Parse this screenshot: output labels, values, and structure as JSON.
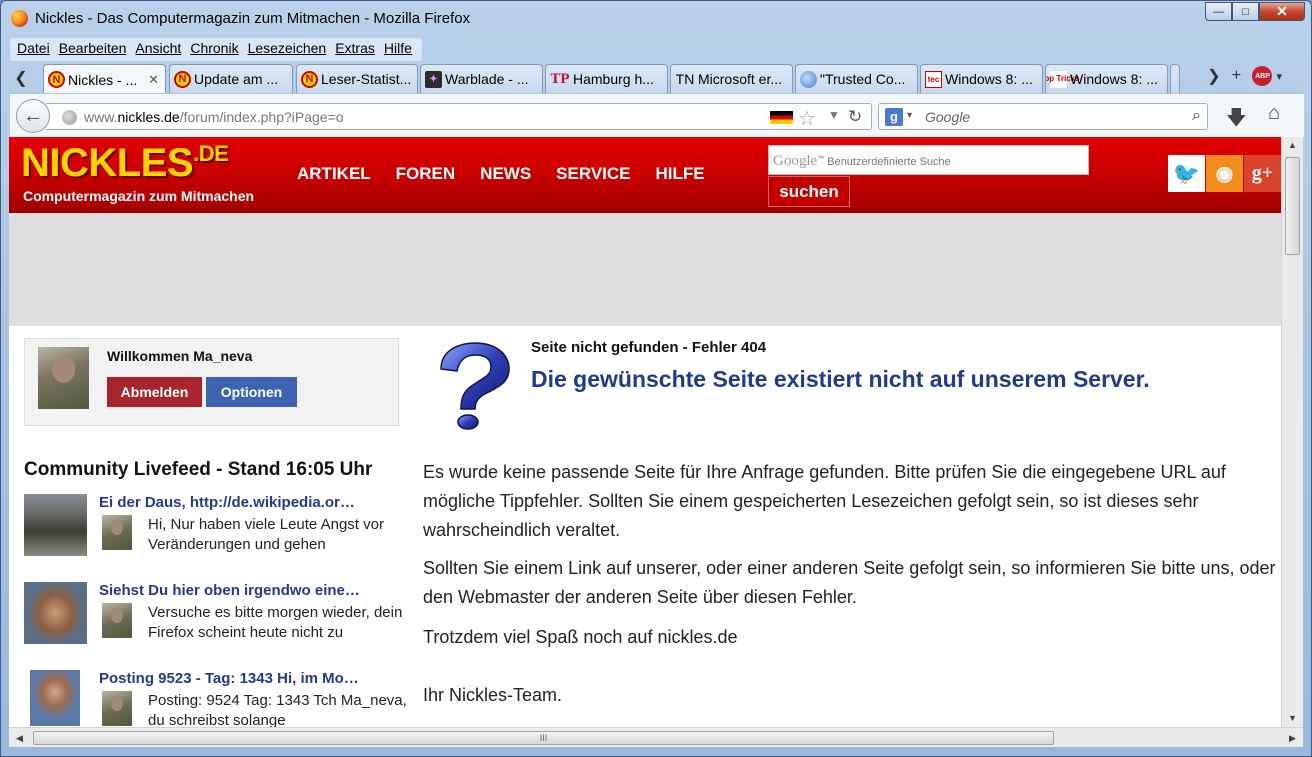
{
  "window": {
    "title": "Nickles - Das Computermagazin zum Mitmachen - Mozilla Firefox",
    "controls": {
      "minimize": "—",
      "maximize": "□",
      "close": "✕"
    }
  },
  "menubar": [
    "Datei",
    "Bearbeiten",
    "Ansicht",
    "Chronik",
    "Lesezeichen",
    "Extras",
    "Hilfe"
  ],
  "tabs": [
    {
      "label": "Nickles - ...",
      "icon": "nickles-n-icon",
      "active": true,
      "close": "✕"
    },
    {
      "label": "Update am ...",
      "icon": "nickles-n-icon"
    },
    {
      "label": "Leser-Statist...",
      "icon": "nickles-n-icon"
    },
    {
      "label": "Warblade - ...",
      "icon": "warblade-icon"
    },
    {
      "label": "Hamburg h...",
      "icon": "tp-icon",
      "icon_text": "TP"
    },
    {
      "label": "Microsoft er...",
      "icon": "tn-icon",
      "icon_text": "TN"
    },
    {
      "label": "\"Trusted Co...",
      "icon": "globe-icon"
    },
    {
      "label": "Windows 8: ...",
      "icon": "tec-icon",
      "icon_text": "tec"
    },
    {
      "label": "Windows 8: ...",
      "icon": "tipp-icon",
      "icon_text": "Tipp Tricks"
    }
  ],
  "tab_tools": {
    "scroll_left": "❮",
    "scroll_right": "❯",
    "new_tab": "+",
    "abp": "ABP",
    "abp_drop": "▾"
  },
  "navbar": {
    "back": "←",
    "url_prefix": "www.",
    "url_domain": "nickles.de",
    "url_path": "/forum/index.php?iPage=o",
    "search_placeholder": "Google",
    "search_engine_icon": "g",
    "search_drop": "▾",
    "search_glyph": "⌕",
    "star": "☆",
    "url_drop": "▼",
    "reload": "↻",
    "download": "🡇",
    "home": "⌂"
  },
  "site": {
    "logo": "NICKLES",
    "logo_tld": ".DE",
    "tagline": "Computermagazin zum Mitmachen",
    "nav": [
      "ARTIKEL",
      "FOREN",
      "NEWS",
      "SERVICE",
      "HILFE"
    ],
    "search_brand": "Google",
    "search_brand_tm": "™",
    "search_placeholder": "Benutzerdefinierte Suche",
    "search_button": "suchen",
    "social": {
      "twitter": "🐦",
      "rss": "◉",
      "gplus": "g+"
    }
  },
  "user": {
    "welcome": "Willkommen Ma_neva",
    "logout": "Abmelden",
    "options": "Optionen"
  },
  "feed": {
    "title": "Community Livefeed - Stand 16:05 Uhr",
    "items": [
      {
        "headline": "Ei der Daus, http://de.wikipedia.or…",
        "text": "Hi, Nur haben viele Leute Angst vor Veränderungen und gehen"
      },
      {
        "headline": "Siehst Du hier oben irgendwo eine…",
        "text": "Versuche es bitte morgen wieder, dein Firefox scheint heute nicht zu"
      },
      {
        "headline": "Posting 9523 - Tag: 1343 Hi, im Mo…",
        "text": "Posting: 9524 Tag: 1343 Tch Ma_neva, du schreibst solange"
      }
    ]
  },
  "error": {
    "subtitle": "Seite nicht gefunden - Fehler 404",
    "headline": "Die gewünschte Seite existiert nicht auf unserem Server.",
    "p1": "Es wurde keine passende Seite für Ihre Anfrage gefunden. Bitte prüfen Sie die eingegebene URL auf mögliche Tippfehler. Sollten Sie einem gespeicherten Lesezeichen gefolgt sein, so ist dieses sehr wahrscheindlich veraltet.",
    "p2": "Sollten Sie einem Link auf unserer, oder einer anderen Seite gefolgt sein, so informieren Sie bitte uns, oder den Webmaster der anderen Seite über diesen Fehler.",
    "p3": "Trotzdem viel Spaß noch auf nickles.de",
    "p4": "Ihr Nickles-Team."
  },
  "scrollbars": {
    "up": "▲",
    "down": "▼",
    "left": "◀",
    "right": "▶",
    "grip": "III"
  },
  "colors": {
    "brand_red": "#c40000",
    "logo_yellow": "#ffd400",
    "link_blue": "#243b8b",
    "logout_red": "#a7262b",
    "options_blue": "#3e63b0"
  }
}
